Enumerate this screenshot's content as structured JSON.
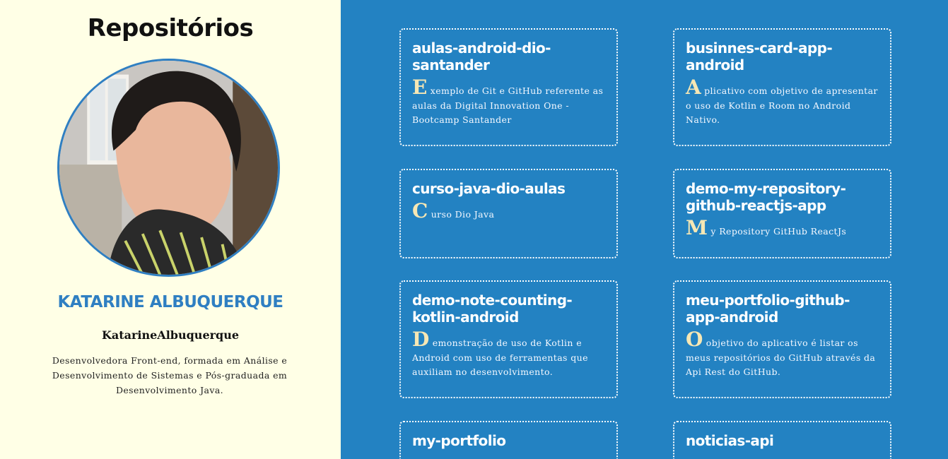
{
  "page": {
    "title": "Repositórios"
  },
  "profile": {
    "name": "KATARINE ALBUQUERQUE",
    "login": "KatarineAlbuquerque",
    "bio": "Desenvolvedora Front-end, formada em Análise e Desenvolvimento de Sistemas e Pós-graduada em Desenvolvimento Java.",
    "avatar_icon": "profile-photo"
  },
  "colors": {
    "sidebar_bg": "#ffffe6",
    "panel_bg": "#2382c2",
    "accent": "#2f7fc2",
    "drop_cap": "#f6e7b4"
  },
  "repos": [
    {
      "name": "aulas-android-dio-santander",
      "initial": "E",
      "description": "xemplo de Git e GitHub referente as aulas da Digital Innovation One - Bootcamp Santander"
    },
    {
      "name": "businnes-card-app-android",
      "initial": "A",
      "description": "plicativo com objetivo de apresentar o uso de Kotlin e Room no Android Nativo."
    },
    {
      "name": "curso-java-dio-aulas",
      "initial": "C",
      "description": "urso Dio Java"
    },
    {
      "name": "demo-my-repository-github-reactjs-app",
      "initial": "M",
      "description": "y Repository GitHub ReactJs"
    },
    {
      "name": "demo-note-counting-kotlin-android",
      "initial": "D",
      "description": "emonstração de uso de Kotlin e Android com uso de ferramentas que auxiliam no desenvolvimento."
    },
    {
      "name": "meu-portfolio-github-app-android",
      "initial": "O",
      "description": "objetivo do aplicativo é listar os meus repositórios do GitHub através da Api Rest do GitHub."
    },
    {
      "name": "my-portfolio",
      "initial": "",
      "description": ""
    },
    {
      "name": "noticias-api",
      "initial": "",
      "description": ""
    }
  ]
}
